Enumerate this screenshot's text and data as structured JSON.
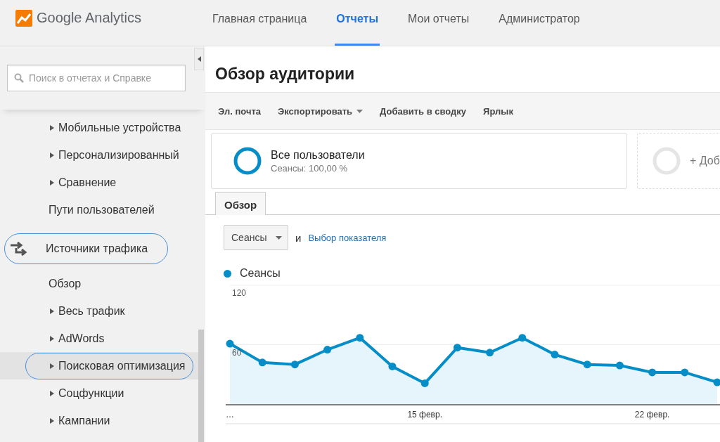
{
  "logo": {
    "text": "Google Analytics"
  },
  "nav": [
    {
      "label": "Главная страница",
      "selected": false
    },
    {
      "label": "Отчеты",
      "selected": true
    },
    {
      "label": "Мои отчеты",
      "selected": false
    },
    {
      "label": "Администратор",
      "selected": false
    }
  ],
  "sidebar": {
    "search": {
      "placeholder": "Поиск в отчетах и Справке"
    },
    "items": [
      {
        "kind": "expandable",
        "label": "Мобильные устройства",
        "selected": false,
        "highlighted": false
      },
      {
        "kind": "expandable",
        "label": "Персонализированный",
        "selected": false,
        "highlighted": false
      },
      {
        "kind": "expandable",
        "label": "Сравнение",
        "selected": false,
        "highlighted": false
      },
      {
        "kind": "plain",
        "label": "Пути пользователей",
        "selected": false,
        "highlighted": false
      },
      {
        "kind": "section",
        "label": "Источники трафика",
        "selected": false,
        "highlighted": true
      },
      {
        "kind": "plain",
        "label": "Обзор",
        "selected": false,
        "highlighted": false
      },
      {
        "kind": "expandable",
        "label": "Весь трафик",
        "selected": false,
        "highlighted": false
      },
      {
        "kind": "expandable",
        "label": "AdWords",
        "selected": false,
        "highlighted": false
      },
      {
        "kind": "expandable",
        "label": "Поисковая оптимизация",
        "selected": true,
        "highlighted": true
      },
      {
        "kind": "expandable",
        "label": "Соцфункции",
        "selected": false,
        "highlighted": false
      },
      {
        "kind": "expandable",
        "label": "Кампании",
        "selected": false,
        "highlighted": false
      }
    ]
  },
  "page": {
    "title": "Обзор аудитории",
    "toolbar": [
      {
        "label": "Эл. почта",
        "dropdown": false
      },
      {
        "label": "Экспортировать",
        "dropdown": true
      },
      {
        "label": "Добавить в сводку",
        "dropdown": false
      },
      {
        "label": "Ярлык",
        "dropdown": false
      }
    ],
    "segments": [
      {
        "kind": "active",
        "name": "Все пользователи",
        "detail": "Сеансы: 100,00 %"
      },
      {
        "kind": "add",
        "name": "+ Доб"
      }
    ],
    "tabs": [
      {
        "label": "Обзор",
        "selected": true
      }
    ],
    "metric_select": {
      "value": "Сеансы"
    },
    "conjunction": "и",
    "metric_link": "Выбор показателя",
    "chart_data": {
      "type": "area",
      "categories": [
        "…",
        null,
        null,
        null,
        null,
        null,
        "15 февр.",
        null,
        null,
        null,
        null,
        null,
        null,
        "22 февр.",
        null,
        null
      ],
      "series": [
        {
          "name": "Сеансы",
          "color": "#058dc7",
          "values": [
            61,
            42,
            40,
            55,
            67,
            38,
            21,
            57,
            52,
            67,
            50,
            40,
            39,
            32,
            32,
            22
          ]
        }
      ],
      "ylim": [
        0,
        120
      ],
      "yticks": [
        {
          "value": 60,
          "label": "60"
        },
        {
          "value": 120,
          "label": "120"
        }
      ]
    }
  }
}
